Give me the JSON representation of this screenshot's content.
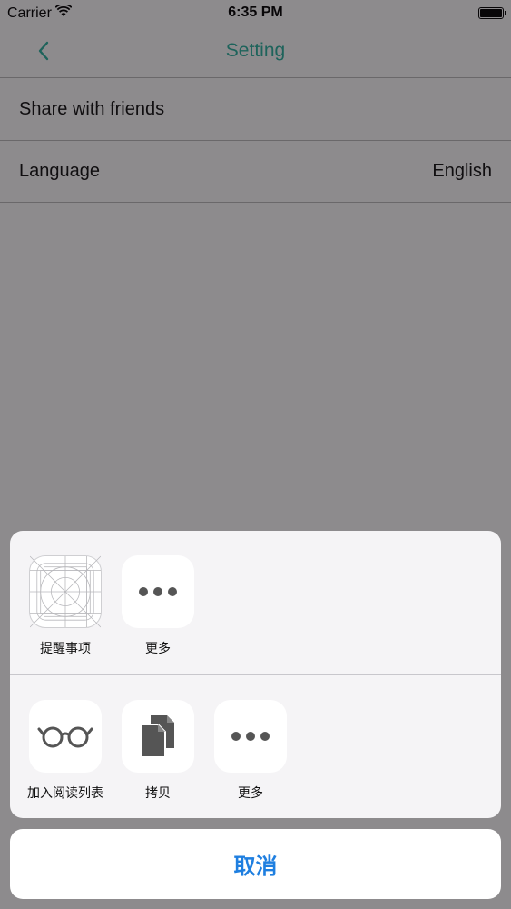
{
  "status_bar": {
    "carrier": "Carrier",
    "time": "6:35 PM",
    "icons": [
      "wifi-icon",
      "battery-icon"
    ]
  },
  "nav": {
    "title": "Setting",
    "back_icon": "chevron-left-icon",
    "accent_color": "#2bb3a0"
  },
  "settings": {
    "rows": [
      {
        "label": "Share with friends",
        "value": ""
      },
      {
        "label": "Language",
        "value": "English"
      }
    ]
  },
  "share_sheet": {
    "apps": [
      {
        "label": "提醒事项",
        "icon": "reminders-icon"
      },
      {
        "label": "更多",
        "icon": "more-icon"
      }
    ],
    "actions": [
      {
        "label": "加入阅读列表",
        "icon": "reading-glasses-icon"
      },
      {
        "label": "拷贝",
        "icon": "copy-icon"
      },
      {
        "label": "更多",
        "icon": "more-icon"
      }
    ],
    "cancel_label": "取消",
    "cancel_color": "#1f7fe0"
  }
}
